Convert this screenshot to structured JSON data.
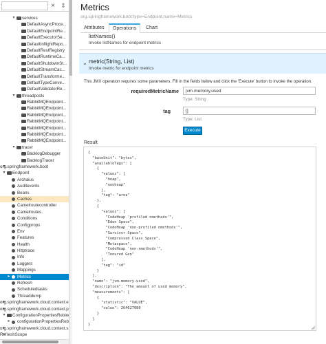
{
  "sidebar": {
    "search": {
      "value": "",
      "placeholder": "",
      "clear_glyph": "×",
      "menu_glyph": "⇕"
    },
    "nodes": [
      {
        "label": "services",
        "depth": 2,
        "icon": "folder",
        "toggle": "▾"
      },
      {
        "label": "DefaultAsyncProce...",
        "depth": 3,
        "icon": "folder"
      },
      {
        "label": "DefaultEndpointRe...",
        "depth": 3,
        "icon": "folder"
      },
      {
        "label": "DefaultExecutorSe...",
        "depth": 3,
        "icon": "folder"
      },
      {
        "label": "DefaultInflightRepo...",
        "depth": 3,
        "icon": "folder"
      },
      {
        "label": "DefaultRestRegistry",
        "depth": 3,
        "icon": "folder"
      },
      {
        "label": "DefaultRuntimeCa...",
        "depth": 3,
        "icon": "folder"
      },
      {
        "label": "DefaultShutdownSt...",
        "depth": 3,
        "icon": "folder"
      },
      {
        "label": "DefaultStreamCac...",
        "depth": 3,
        "icon": "folder"
      },
      {
        "label": "DefaultTransforme...",
        "depth": 3,
        "icon": "folder"
      },
      {
        "label": "DefaultTypeConve...",
        "depth": 3,
        "icon": "folder"
      },
      {
        "label": "DefaultValidatorRe...",
        "depth": 3,
        "icon": "folder"
      },
      {
        "label": "threadpools",
        "depth": 2,
        "icon": "folder",
        "toggle": "▾"
      },
      {
        "label": "RabbitMQEndpoint...",
        "depth": 3,
        "icon": "folder"
      },
      {
        "label": "RabbitMQEndpoint...",
        "depth": 3,
        "icon": "folder"
      },
      {
        "label": "RabbitMQEndpoint...",
        "depth": 3,
        "icon": "folder"
      },
      {
        "label": "RabbitMQEndpoint...",
        "depth": 3,
        "icon": "folder"
      },
      {
        "label": "RabbitMQEndpoint...",
        "depth": 3,
        "icon": "folder"
      },
      {
        "label": "RabbitMQEndpoint...",
        "depth": 3,
        "icon": "folder"
      },
      {
        "label": "RabbitMQEndpoint...",
        "depth": 3,
        "icon": "folder"
      },
      {
        "label": "tracer",
        "depth": 2,
        "icon": "folder",
        "toggle": "▾"
      },
      {
        "label": "BacklogDebugger",
        "depth": 3,
        "icon": "folder"
      },
      {
        "label": "BacklogTracer",
        "depth": 3,
        "icon": "folder"
      },
      {
        "label": "org.springframework.boot",
        "depth": 0,
        "icon": "none",
        "toggle": "▾"
      },
      {
        "label": "Endpoint",
        "depth": 0,
        "icon": "folder",
        "toggle": "▾"
      },
      {
        "label": "Archaius",
        "depth": 1,
        "icon": "bean"
      },
      {
        "label": "Auditevents",
        "depth": 1,
        "icon": "bean"
      },
      {
        "label": "Beans",
        "depth": 1,
        "icon": "bean"
      },
      {
        "label": "Caches",
        "depth": 1,
        "icon": "bean",
        "state": "hover"
      },
      {
        "label": "Camelroutecontroller",
        "depth": 1,
        "icon": "bean"
      },
      {
        "label": "Camelroutes",
        "depth": 1,
        "icon": "bean"
      },
      {
        "label": "Conditions",
        "depth": 1,
        "icon": "bean"
      },
      {
        "label": "Configprops",
        "depth": 1,
        "icon": "bean"
      },
      {
        "label": "Env",
        "depth": 1,
        "icon": "bean"
      },
      {
        "label": "Features",
        "depth": 1,
        "icon": "bean"
      },
      {
        "label": "Health",
        "depth": 1,
        "icon": "bean"
      },
      {
        "label": "Httptrace",
        "depth": 1,
        "icon": "bean"
      },
      {
        "label": "Info",
        "depth": 1,
        "icon": "bean"
      },
      {
        "label": "Loggers",
        "depth": 1,
        "icon": "bean"
      },
      {
        "label": "Mappings",
        "depth": 1,
        "icon": "bean"
      },
      {
        "label": "Metrics",
        "depth": 1,
        "icon": "bean",
        "state": "selected",
        "toggle": "▸"
      },
      {
        "label": "Refresh",
        "depth": 1,
        "icon": "bean"
      },
      {
        "label": "Scheduledtasks",
        "depth": 1,
        "icon": "bean"
      },
      {
        "label": "Threaddump",
        "depth": 1,
        "icon": "bean"
      },
      {
        "label": "org.springframework.cloud.context.e...",
        "depth": 0,
        "icon": "none",
        "toggle": "▸"
      },
      {
        "label": "org.springframework.cloud.context.p...",
        "depth": 0,
        "icon": "none",
        "toggle": "▸"
      },
      {
        "label": "ConfigurationPropertiesRebinder",
        "depth": 0,
        "icon": "folder",
        "toggle": "▾"
      },
      {
        "label": "configurationPropertiesRebin...",
        "depth": 1,
        "icon": "bean",
        "toggle": "▸"
      },
      {
        "label": "org.springframework.cloud.context.s...",
        "depth": 0,
        "icon": "none",
        "toggle": "▸"
      },
      {
        "label": "RefreshScope",
        "depth": 0,
        "icon": "none",
        "toggle": "▸"
      }
    ]
  },
  "main": {
    "title": "Metrics",
    "mbean_name": "org.springframework.boot:type=Endpoint,name=Metrics",
    "tabs": [
      {
        "label": "Attributes",
        "active": false
      },
      {
        "label": "Operations",
        "active": true
      },
      {
        "label": "Chart",
        "active": false
      }
    ],
    "prev_operation": {
      "signature": "listNames()",
      "description": "Invoke listNames for endpoint metrics"
    },
    "operation": {
      "chevron": "⌄",
      "signature": "metric(String, List)",
      "description": "Invoke metric for endpoint metrics",
      "note": "This JMX operation requires some parameters. Fill in the fields below and click the 'Execute' button to invoke the operation.",
      "params": [
        {
          "label": "requiredMetricName",
          "value": "jvm.memory.used",
          "type": "Type: String"
        },
        {
          "label": "tag",
          "value": "[]",
          "type": "Type: List"
        }
      ],
      "execute_label": "Execute"
    },
    "result": {
      "label": "Result",
      "text": "{\n  \"baseUnit\": \"bytes\",\n  \"availableTags\": [\n    {\n      \"values\": [\n        \"heap\",\n        \"nonheap\"\n      ],\n      \"tag\": \"area\"\n    },\n    {\n      \"values\": [\n        \"CodeHeap 'profiled nmethods'\",\n        \"Eden Space\",\n        \"CodeHeap 'non-profiled nmethods'\",\n        \"Survivor Space\",\n        \"Compressed Class Space\",\n        \"Metaspace\",\n        \"CodeHeap 'non-nmethods'\",\n        \"Tenured Gen\"\n      ],\n      \"tag\": \"id\"\n    }\n  ],\n  \"name\": \"jvm.memory.used\",\n  \"description\": \"The amount of used memory\",\n  \"measurements\": [\n    {\n      \"statistic\": \"VALUE\",\n      \"value\": 264627080\n    }\n  ]\n}"
    }
  },
  "colors": {
    "accent": "#0088ce",
    "tab_active_border": "#39a5dc",
    "operation_header_bg": "#def3ff",
    "hover_row": "#fce8c0"
  }
}
